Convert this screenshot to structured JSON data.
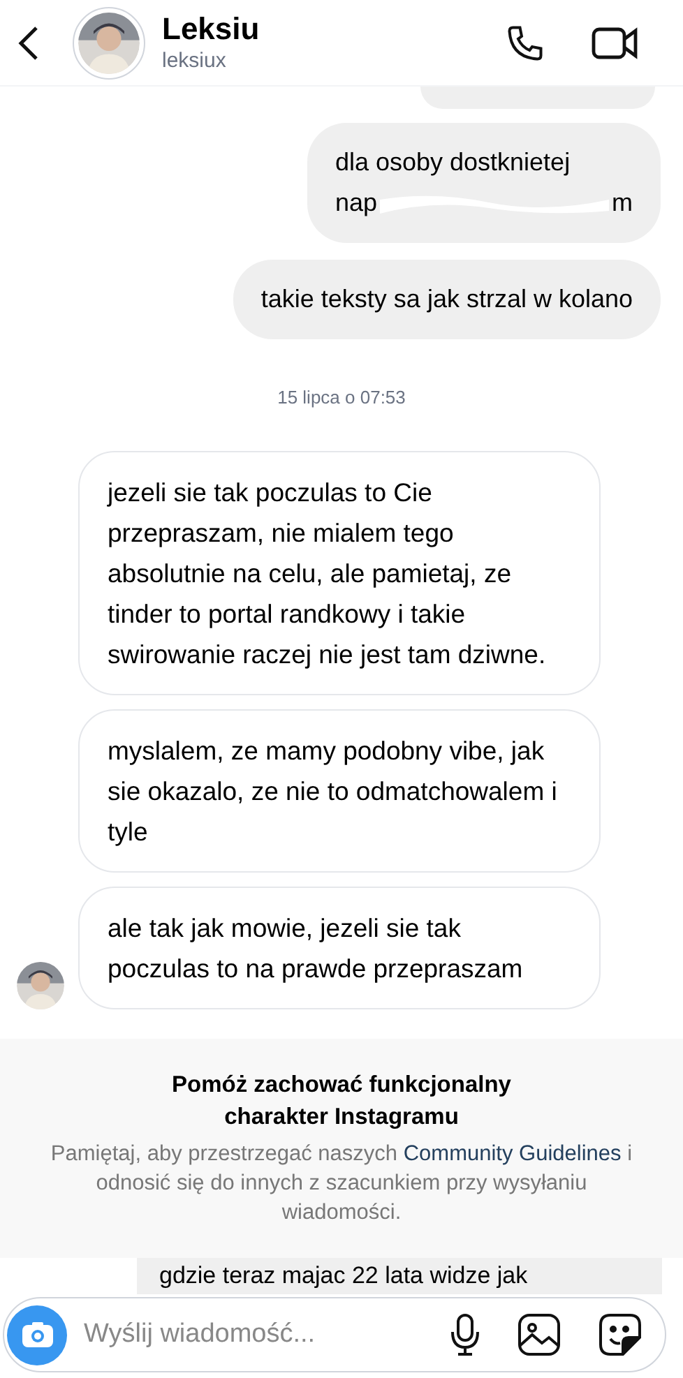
{
  "header": {
    "name": "Leksiu",
    "username": "leksiux"
  },
  "messages": [
    {
      "kind": "outgoing",
      "lines": [
        "dla osoby dostknietej"
      ],
      "redacted_start": "nap",
      "redacted_end": "m"
    },
    {
      "kind": "outgoing",
      "lines": [
        "takie teksty sa jak strzal w kolano"
      ]
    },
    {
      "kind": "timestamp",
      "lines": [
        "15 lipca o 07:53"
      ]
    },
    {
      "kind": "incoming",
      "lines": [
        "jezeli sie tak poczulas to Cie przepraszam, nie mialem tego absolutnie na celu, ale pamietaj, ze tinder to portal randkowy i takie swirowanie raczej nie jest tam dziwne."
      ],
      "avatar": false
    },
    {
      "kind": "incoming",
      "lines": [
        "myslalem, ze mamy podobny vibe, jak sie okazalo, ze nie to odmatchowalem i tyle"
      ],
      "avatar": false
    },
    {
      "kind": "incoming",
      "lines": [
        "ale tak jak mowie, jezeli sie tak poczulas to na prawde przepraszam"
      ],
      "avatar": true
    }
  ],
  "notice": {
    "title": "Pomóż zachować funkcjonalny charakter Instagramu",
    "text_before": "Pamiętaj, aby przestrzegać naszych",
    "link": "Community Guidelines",
    "text_after": "i odnosić się do innych z szacunkiem przy wysyłaniu wiadomości."
  },
  "partial_message": "gdzie teraz majac 22 lata widze jak",
  "composer": {
    "placeholder": "Wyślij wiadomość..."
  }
}
